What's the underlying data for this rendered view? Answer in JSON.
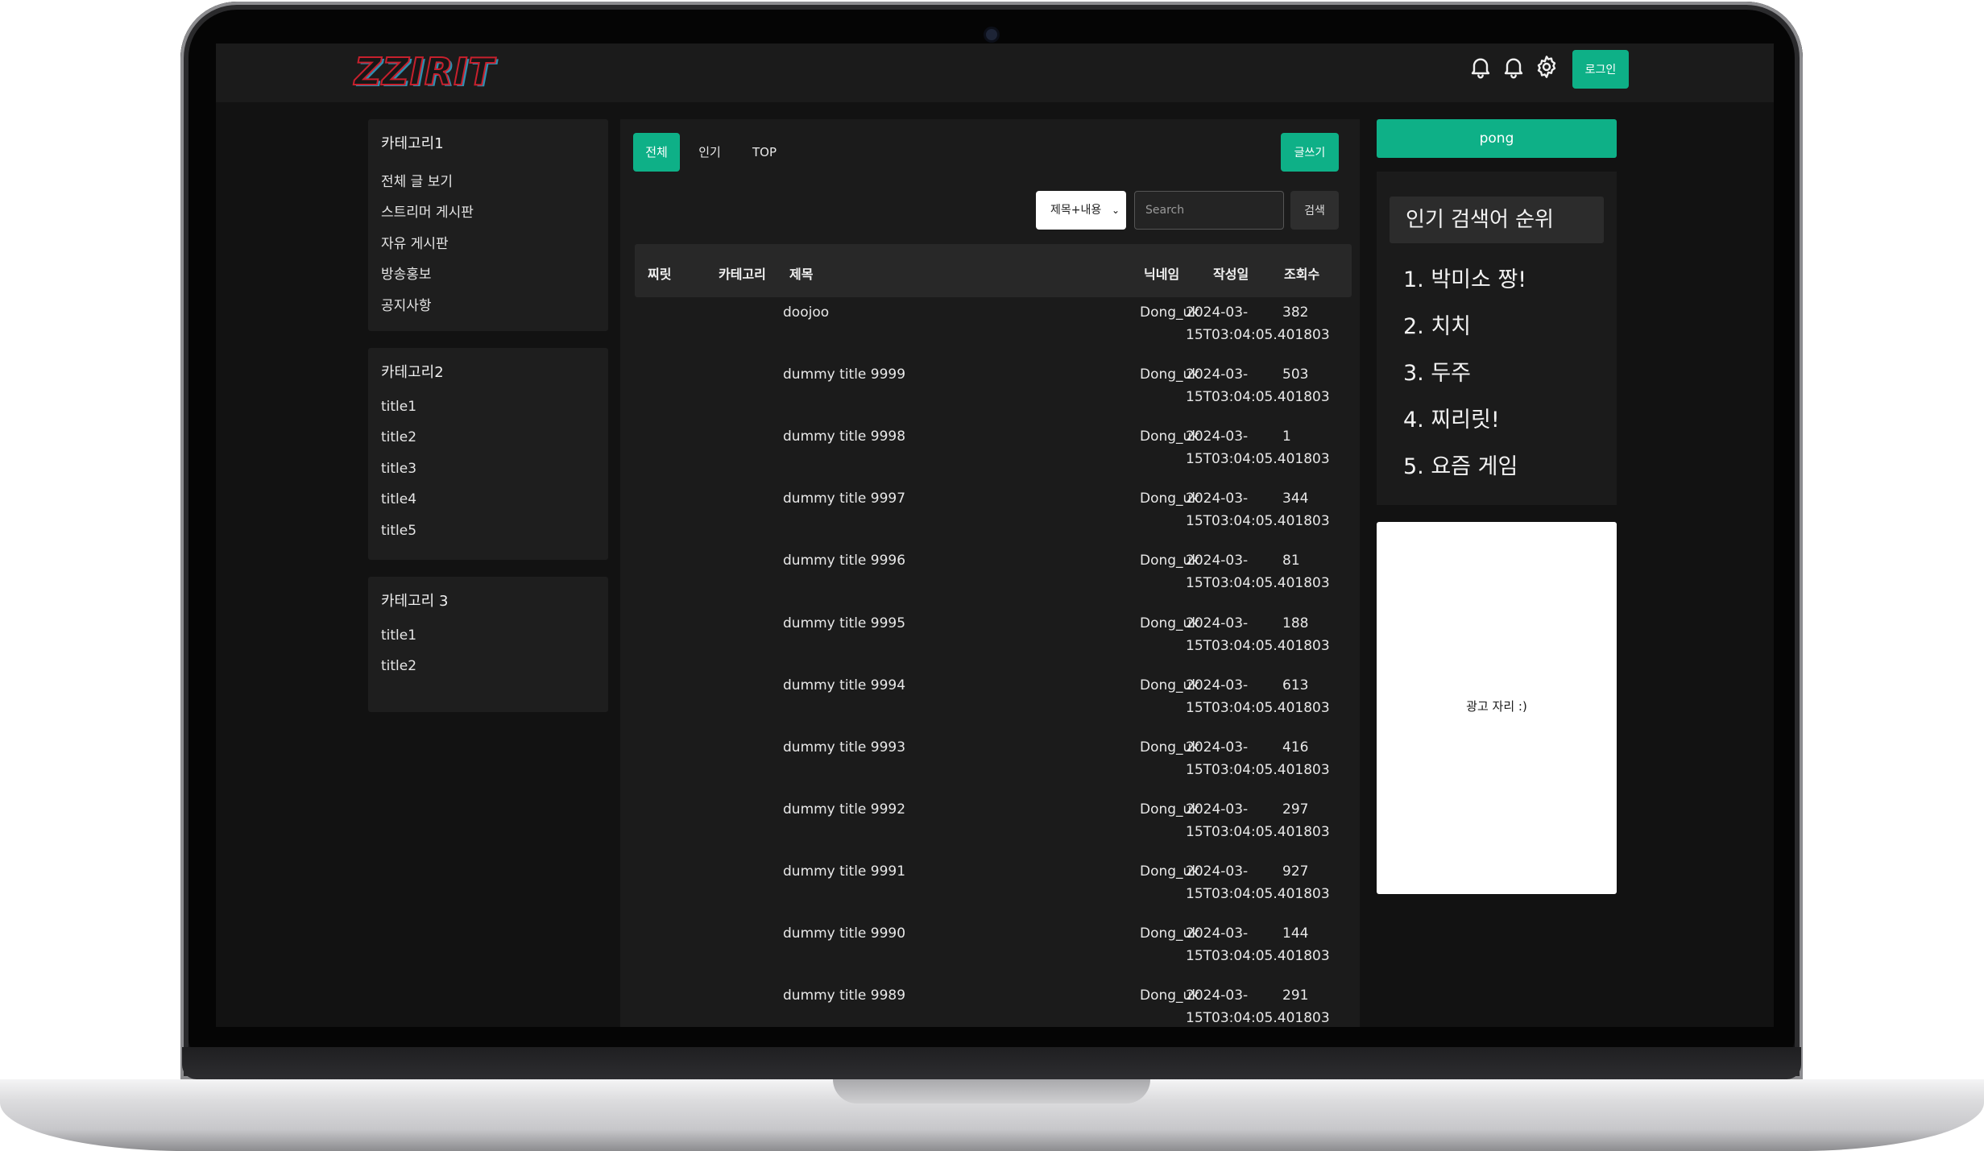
{
  "header": {
    "logo": "ZZIRIT",
    "icons": [
      "bell-icon",
      "bell-icon",
      "gear-icon"
    ],
    "login_label": "로그인"
  },
  "sidebar": {
    "categories": [
      {
        "title": "카테고리1",
        "items": [
          "전체 글 보기",
          "스트리머 게시판",
          "자유 게시판",
          "방송홍보",
          "공지사항"
        ]
      },
      {
        "title": "카테고리2",
        "items": [
          "title1",
          "title2",
          "title3",
          "title4",
          "title5"
        ]
      },
      {
        "title": "카테고리 3",
        "items": [
          "title1",
          "title2"
        ]
      }
    ]
  },
  "board": {
    "tabs": [
      "전체",
      "인기",
      "TOP"
    ],
    "active_tab": "전체",
    "write_label": "글쓰기",
    "search": {
      "selected_option": "제목+내용",
      "placeholder": "Search",
      "button_label": "검색"
    },
    "columns": [
      "찌릿",
      "카테고리",
      "제목",
      "닉네임",
      "작성일",
      "조회수"
    ],
    "rows": [
      {
        "title": "doojoo",
        "nickname": "Dong_uk",
        "date_line1": "2024-03-",
        "date_line2": "15T03:04:05.401803",
        "views": "382"
      },
      {
        "title": "dummy title 9999",
        "nickname": "Dong_uk",
        "date_line1": "2024-03-",
        "date_line2": "15T03:04:05.401803",
        "views": "503"
      },
      {
        "title": "dummy title 9998",
        "nickname": "Dong_uk",
        "date_line1": "2024-03-",
        "date_line2": "15T03:04:05.401803",
        "views": "1"
      },
      {
        "title": "dummy title 9997",
        "nickname": "Dong_uk",
        "date_line1": "2024-03-",
        "date_line2": "15T03:04:05.401803",
        "views": "344"
      },
      {
        "title": "dummy title 9996",
        "nickname": "Dong_uk",
        "date_line1": "2024-03-",
        "date_line2": "15T03:04:05.401803",
        "views": "81"
      },
      {
        "title": "dummy title 9995",
        "nickname": "Dong_uk",
        "date_line1": "2024-03-",
        "date_line2": "15T03:04:05.401803",
        "views": "188"
      },
      {
        "title": "dummy title 9994",
        "nickname": "Dong_uk",
        "date_line1": "2024-03-",
        "date_line2": "15T03:04:05.401803",
        "views": "613"
      },
      {
        "title": "dummy title 9993",
        "nickname": "Dong_uk",
        "date_line1": "2024-03-",
        "date_line2": "15T03:04:05.401803",
        "views": "416"
      },
      {
        "title": "dummy title 9992",
        "nickname": "Dong_uk",
        "date_line1": "2024-03-",
        "date_line2": "15T03:04:05.401803",
        "views": "297"
      },
      {
        "title": "dummy title 9991",
        "nickname": "Dong_uk",
        "date_line1": "2024-03-",
        "date_line2": "15T03:04:05.401803",
        "views": "927"
      },
      {
        "title": "dummy title 9990",
        "nickname": "Dong_uk",
        "date_line1": "2024-03-",
        "date_line2": "15T03:04:05.401803",
        "views": "144"
      },
      {
        "title": "dummy title 9989",
        "nickname": "Dong_uk",
        "date_line1": "2024-03-",
        "date_line2": "15T03:04:05.401803",
        "views": "291"
      }
    ]
  },
  "right": {
    "pong_label": "pong",
    "ranking_title": "인기 검색어 순위",
    "ranking": [
      "1. 박미소 짱!",
      "2. 치치",
      "3. 두주",
      "4. 찌리릿!",
      "5. 요즘 게임"
    ],
    "ad_text": "광고 자리 :)"
  },
  "colors": {
    "accent": "#0eb087",
    "background": "#121212",
    "panel": "#1b1b1b",
    "logo_red": "#c7202d",
    "logo_blue": "#2f8fb0"
  }
}
